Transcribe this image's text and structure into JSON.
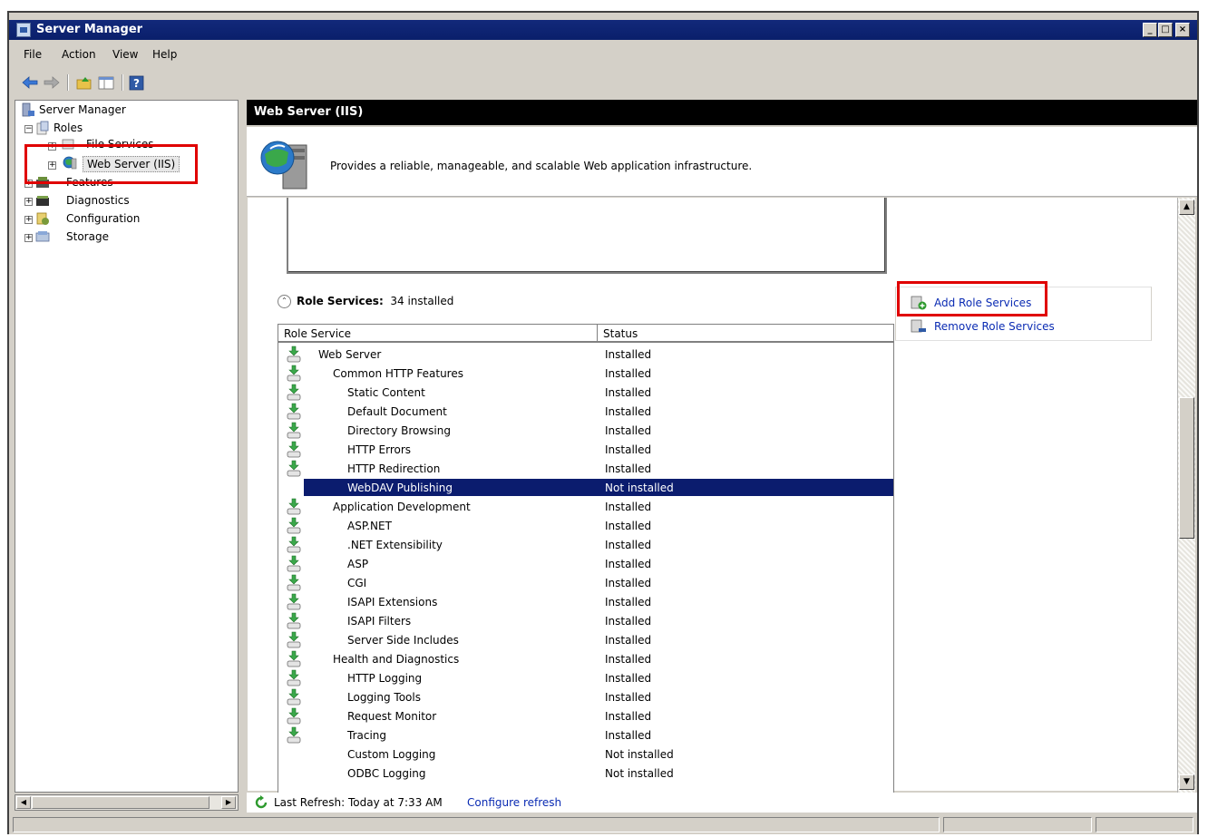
{
  "window": {
    "title": "Server Manager"
  },
  "menu": [
    "File",
    "Action",
    "View",
    "Help"
  ],
  "toolbar": [
    "back-arrow-icon",
    "forward-arrow-icon",
    "up-folder-icon",
    "show-hide-pane-icon",
    "help-icon"
  ],
  "tree": {
    "root": "Server Manager",
    "roles": "Roles",
    "file_services": "File Services",
    "web_server": "Web Server (IIS)",
    "features": "Features",
    "diagnostics": "Diagnostics",
    "configuration": "Configuration",
    "storage": "Storage"
  },
  "header": {
    "title": "Web Server (IIS)"
  },
  "description": "Provides a reliable, manageable, and scalable Web application infrastructure.",
  "role_services": {
    "heading": "Role Services:",
    "count_text": "34 installed",
    "columns": [
      "Role Service",
      "Status"
    ],
    "rows": [
      {
        "name": "Web Server",
        "status": "Installed",
        "level": 1,
        "icon": true
      },
      {
        "name": "Common HTTP Features",
        "status": "Installed",
        "level": 2,
        "icon": true
      },
      {
        "name": "Static Content",
        "status": "Installed",
        "level": 3,
        "icon": true
      },
      {
        "name": "Default Document",
        "status": "Installed",
        "level": 3,
        "icon": true
      },
      {
        "name": "Directory Browsing",
        "status": "Installed",
        "level": 3,
        "icon": true
      },
      {
        "name": "HTTP Errors",
        "status": "Installed",
        "level": 3,
        "icon": true
      },
      {
        "name": "HTTP Redirection",
        "status": "Installed",
        "level": 3,
        "icon": true
      },
      {
        "name": "WebDAV Publishing",
        "status": "Not installed",
        "level": 3,
        "icon": false,
        "selected": true
      },
      {
        "name": "Application Development",
        "status": "Installed",
        "level": 2,
        "icon": true
      },
      {
        "name": "ASP.NET",
        "status": "Installed",
        "level": 3,
        "icon": true
      },
      {
        "name": ".NET Extensibility",
        "status": "Installed",
        "level": 3,
        "icon": true
      },
      {
        "name": "ASP",
        "status": "Installed",
        "level": 3,
        "icon": true
      },
      {
        "name": "CGI",
        "status": "Installed",
        "level": 3,
        "icon": true
      },
      {
        "name": "ISAPI Extensions",
        "status": "Installed",
        "level": 3,
        "icon": true
      },
      {
        "name": "ISAPI Filters",
        "status": "Installed",
        "level": 3,
        "icon": true
      },
      {
        "name": "Server Side Includes",
        "status": "Installed",
        "level": 3,
        "icon": true
      },
      {
        "name": "Health and Diagnostics",
        "status": "Installed",
        "level": 2,
        "icon": true
      },
      {
        "name": "HTTP Logging",
        "status": "Installed",
        "level": 3,
        "icon": true
      },
      {
        "name": "Logging Tools",
        "status": "Installed",
        "level": 3,
        "icon": true
      },
      {
        "name": "Request Monitor",
        "status": "Installed",
        "level": 3,
        "icon": true
      },
      {
        "name": "Tracing",
        "status": "Installed",
        "level": 3,
        "icon": true
      },
      {
        "name": "Custom Logging",
        "status": "Not installed",
        "level": 3,
        "icon": false
      },
      {
        "name": "ODBC Logging",
        "status": "Not installed",
        "level": 3,
        "icon": false
      }
    ]
  },
  "actions": {
    "add": "Add Role Services",
    "remove": "Remove Role Services"
  },
  "refresh": {
    "label": "Last Refresh: Today at 7:33 AM",
    "configure": "Configure refresh"
  },
  "colors": {
    "title_bar": "#0a1f6b",
    "selection": "#0b1c6e",
    "link": "#0a2bb3",
    "highlight_box": "#e00000"
  }
}
